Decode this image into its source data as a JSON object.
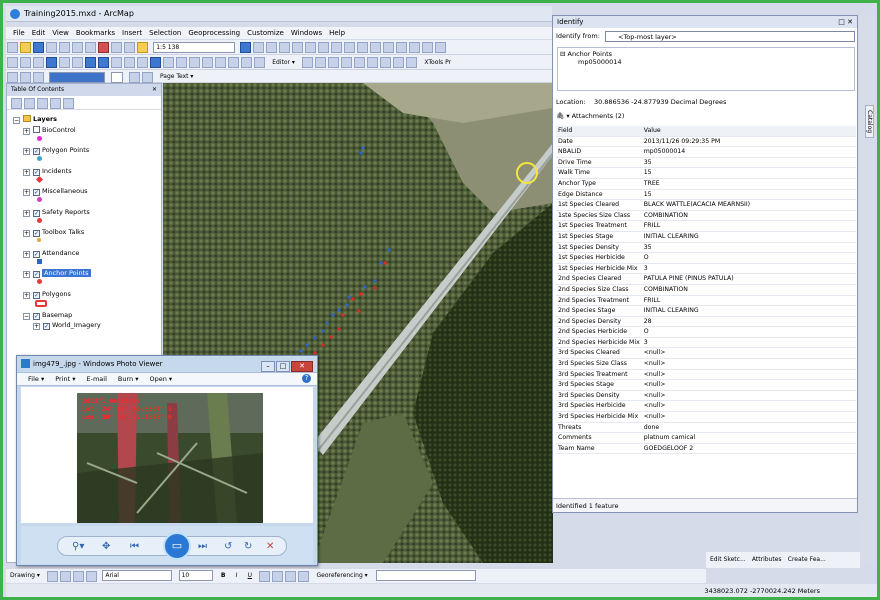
{
  "app": {
    "title": "Training2015.mxd - ArcMap"
  },
  "menu": [
    "File",
    "Edit",
    "View",
    "Bookmarks",
    "Insert",
    "Selection",
    "Geoprocessing",
    "Customize",
    "Windows",
    "Help"
  ],
  "toolbar": {
    "scale": "1:5 138",
    "editor": "Editor ▾",
    "xtools": "XTools Pr",
    "page_text": "Page Text ▾"
  },
  "toc": {
    "title": "Table Of Contents",
    "close": "✕",
    "layers_label": "Layers",
    "items": [
      {
        "label": "BioControl",
        "checked": false,
        "symbol_color": "#e02ad7"
      },
      {
        "label": "Polygon Points",
        "checked": true,
        "symbol_color": "#3fa6c7"
      },
      {
        "label": "Incidents",
        "checked": true,
        "symbol_color": "#e33a3a"
      },
      {
        "label": "Miscellaneous",
        "checked": true,
        "symbol_color": "#d23fbf"
      },
      {
        "label": "Safety Reports",
        "checked": true,
        "symbol_color": "#e33a3a"
      },
      {
        "label": "Toolbox Talks",
        "checked": true,
        "symbol_color": "#f0a23a"
      },
      {
        "label": "Attendance",
        "checked": true,
        "symbol_color": "#2e63c8"
      },
      {
        "label": "Anchor Points",
        "checked": true,
        "symbol_color": "#e33a3a"
      },
      {
        "label": "Polygons",
        "checked": true,
        "symbol_color": "#e33a3a"
      },
      {
        "label": "Basemap",
        "checked": true,
        "symbol_color": ""
      },
      {
        "label": "World_Imagery",
        "checked": true,
        "symbol_color": ""
      }
    ]
  },
  "identify": {
    "title": "Identify",
    "from_label": "Identify from:",
    "from_value": "<Top-most layer>",
    "layer": "Anchor Points",
    "feature": "mp05000014",
    "location_label": "Location:",
    "location_value": "30.886536  -24.877939 Decimal Degrees",
    "attachments": "Attachments (2)",
    "col_field": "Field",
    "col_value": "Value",
    "rows": [
      [
        "Date",
        "2013/11/26 09:29:35 PM"
      ],
      [
        "NBALID",
        "mp05000014"
      ],
      [
        "Drive Time",
        "35"
      ],
      [
        "Walk Time",
        "15"
      ],
      [
        "Anchor Type",
        "TREE"
      ],
      [
        "Edge Distance",
        "15"
      ],
      [
        "1st Species Cleared",
        "BLACK WATTLE(ACACIA MEARNSII)"
      ],
      [
        "1ste Species Size Class",
        "COMBINATION"
      ],
      [
        "1st Species Treatment",
        "FRILL"
      ],
      [
        "1st Species Stage",
        "INITIAL CLEARING"
      ],
      [
        "1st Species Density",
        "35"
      ],
      [
        "1st Species Herbicide",
        "O"
      ],
      [
        "1st Species Herbicide Mix",
        "3"
      ],
      [
        "2nd Species Cleared",
        "PATULA PINE (PINUS PATULA)"
      ],
      [
        "2nd Species Size Class",
        "COMBINATION"
      ],
      [
        "2nd Species Treatment",
        "FRILL"
      ],
      [
        "2nd Species Stage",
        "INITIAL CLEARING"
      ],
      [
        "2nd Species Density",
        "28"
      ],
      [
        "2nd Species Herbicide",
        "O"
      ],
      [
        "2nd Species Herbicide Mix",
        "3"
      ],
      [
        "3rd Species Cleared",
        "<null>"
      ],
      [
        "3rd Species Size Class",
        "<null>"
      ],
      [
        "3rd Species Treatment",
        "<null>"
      ],
      [
        "3rd Species Stage",
        "<null>"
      ],
      [
        "3rd Species Density",
        "<null>"
      ],
      [
        "3rd Species Herbicide",
        "<null>"
      ],
      [
        "3rd Species Herbicide Mix",
        "<null>"
      ],
      [
        "Threats",
        "done"
      ],
      [
        "Comments",
        "platnum camical"
      ],
      [
        "Team Name",
        "GOEDGELOOF 2"
      ]
    ],
    "footer": "Identified 1 feature"
  },
  "photo_viewer": {
    "title": "img479_.jpg - Windows Photo Viewer",
    "menu": [
      "File ▾",
      "Print ▾",
      "E-mail",
      "Burn ▾",
      "Open ▾"
    ],
    "overlay": [
      "2013/1  06:03:57",
      "Lat: 24° 52' 40.5564\" S",
      "Lon: 30° 53' 12.1896\" E"
    ]
  },
  "right_panel": {
    "catalog": "Catalog"
  },
  "bottom_buttons": [
    "Edit Sketc...",
    "Attributes",
    "Create Fea..."
  ],
  "drawing_toolbar": {
    "drawing": "Drawing ▾",
    "font": "Arial",
    "size": "10",
    "georeferencing": "Georeferencing ▾"
  },
  "status": {
    "coords": "3438023.072  -2770024.242 Meters"
  },
  "colors": {
    "frame": "#3fb14a",
    "point_red": "#e32727",
    "point_blue": "#2e63c8",
    "highlight": "#3976d1"
  }
}
